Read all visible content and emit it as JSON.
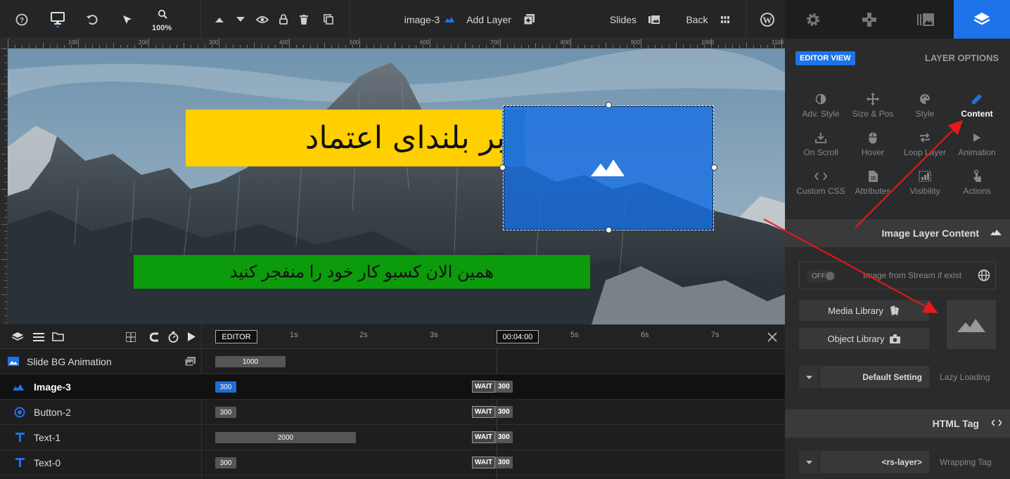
{
  "toolbar": {
    "zoom": "100%",
    "layer_name": "image-3",
    "add_layer": "Add Layer",
    "slides": "Slides",
    "back": "Back"
  },
  "ruler": {
    "marks": [
      "100",
      "200",
      "300",
      "400",
      "500",
      "600",
      "700",
      "800",
      "900",
      "1000",
      "1100"
    ]
  },
  "canvas": {
    "title_text": "بر بلندای اعتماد",
    "subtitle_text": "همین الان کسبو کار خود را منفجر کنید"
  },
  "timeline": {
    "editor_label": "EDITOR",
    "current_time": "00:04:00",
    "seconds": [
      "1s",
      "2s",
      "3s",
      "5s",
      "6s",
      "7s"
    ],
    "rows": [
      {
        "label": "Slide BG Animation",
        "bar": "1000"
      },
      {
        "label": "Image-3",
        "bar": "300",
        "wait": "WAIT",
        "wait_value": "300"
      },
      {
        "label": "Button-2",
        "bar": "300",
        "wait": "WAIT",
        "wait_value": "300"
      },
      {
        "label": "Text-1",
        "bar": "2000",
        "wait": "WAIT",
        "wait_value": "300"
      },
      {
        "label": "Text-0",
        "bar": "300",
        "wait": "WAIT",
        "wait_value": "300"
      }
    ]
  },
  "panel": {
    "editor_view": "EDITOR VIEW",
    "layer_options": "LAYER OPTIONS",
    "grid": [
      {
        "label": "Adv. Style",
        "icon": "contrast-icon"
      },
      {
        "label": "Size & Pos",
        "icon": "move-icon"
      },
      {
        "label": "Style",
        "icon": "palette-icon"
      },
      {
        "label": "Content",
        "icon": "pencil-icon"
      },
      {
        "label": "On Scroll",
        "icon": "download-icon"
      },
      {
        "label": "Hover",
        "icon": "mouse-icon"
      },
      {
        "label": "Loop Layer",
        "icon": "loop-icon"
      },
      {
        "label": "Animation",
        "icon": "play-icon"
      },
      {
        "label": "Custom CSS",
        "icon": "code-icon"
      },
      {
        "label": "Attributes",
        "icon": "file-icon"
      },
      {
        "label": "Visibility",
        "icon": "visibility-icon"
      },
      {
        "label": "Actions",
        "icon": "pointer-icon"
      }
    ],
    "image_section": "Image Layer Content",
    "toggle_off": "OFF",
    "stream_label": "Image from Stream if exist",
    "media_library": "Media Library",
    "object_library": "Object Library",
    "default_setting": "Default Setting",
    "lazy_loading": "Lazy Loading",
    "html_tag_section": "HTML Tag",
    "rs_layer": "<rs-layer>",
    "wrapping_tag": "Wrapping Tag"
  },
  "colors": {
    "accent": "#1e73e8",
    "title_bg": "#ffcf00",
    "subtitle_bg": "#0b9b0b",
    "annotation": "#e8191a"
  }
}
